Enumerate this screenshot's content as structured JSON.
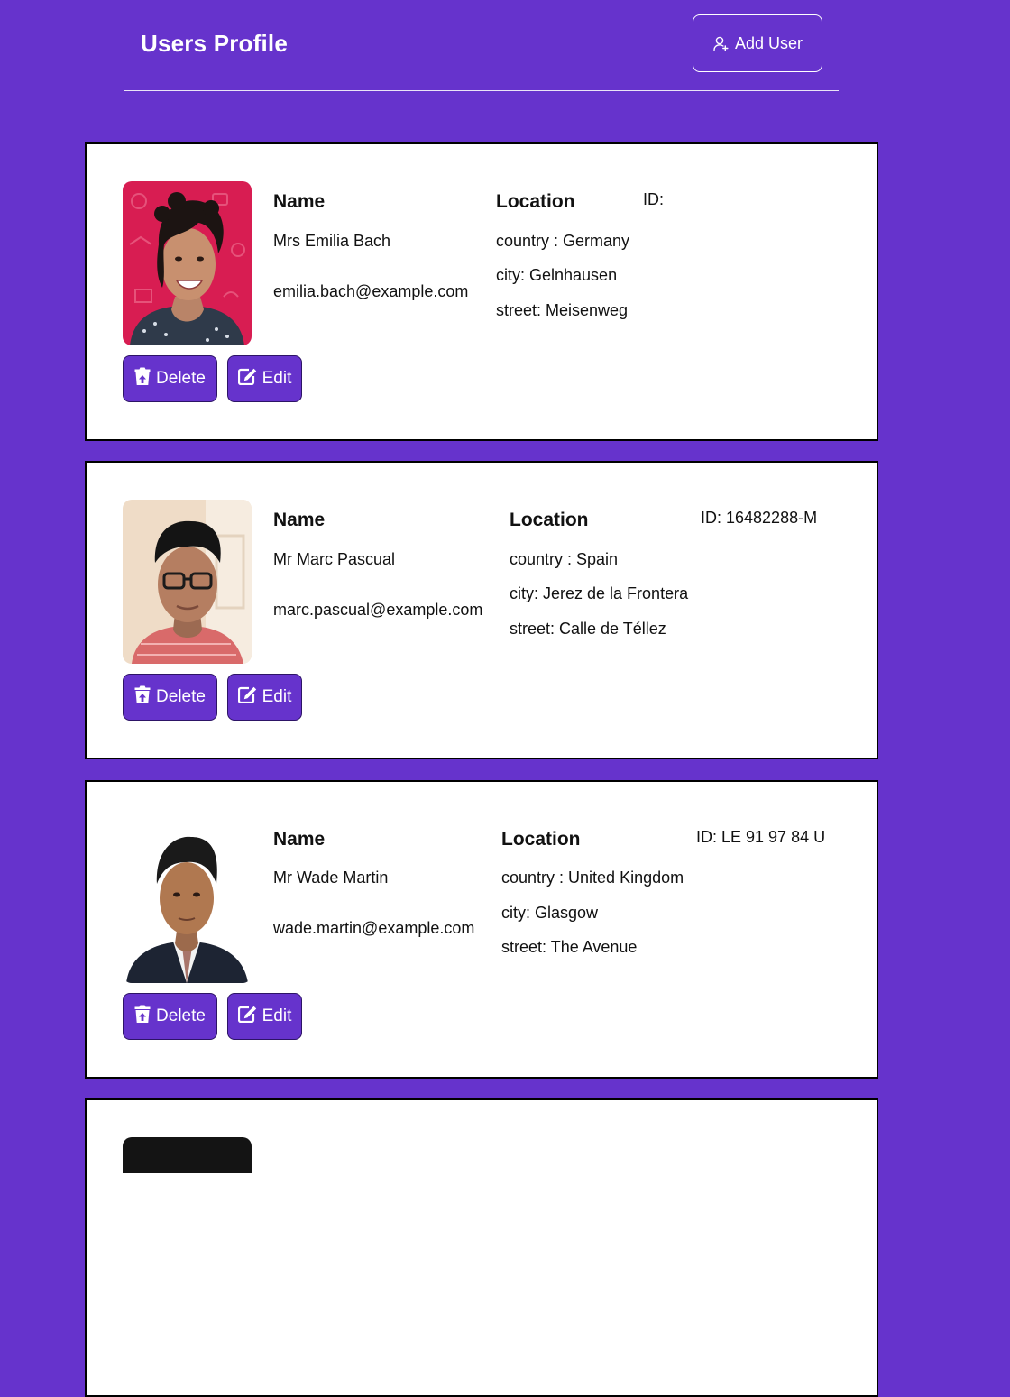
{
  "header": {
    "title": "Users Profile",
    "add_user_label": "Add User",
    "add_user_icon": "user-plus-icon"
  },
  "labels": {
    "name_heading": "Name",
    "location_heading": "Location",
    "country_prefix": "country : ",
    "city_prefix": "city: ",
    "street_prefix": "street: ",
    "id_prefix": "ID: "
  },
  "actions": {
    "delete_label": "Delete",
    "delete_icon": "trash-restore-icon",
    "edit_label": "Edit",
    "edit_icon": "edit-icon"
  },
  "colors": {
    "background": "#6633cc",
    "card": "#ffffff",
    "button": "#6633cc"
  },
  "users": [
    {
      "name": "Mrs Emilia Bach",
      "email": "emilia.bach@example.com",
      "country": "Germany",
      "city": "Gelnhausen",
      "street": "Meisenweg",
      "id": "",
      "country_line": "country : Germany",
      "city_line": "city: Gelnhausen",
      "street_line": "street: Meisenweg",
      "id_line": "ID:",
      "avatar": "user-photo"
    },
    {
      "name": "Mr Marc Pascual",
      "email": "marc.pascual@example.com",
      "country": "Spain",
      "city": "Jerez de la Frontera",
      "street": "Calle de Téllez",
      "id": "16482288-M",
      "country_line": "country : Spain",
      "city_line": "city: Jerez de la Frontera",
      "street_line": "street: Calle de Téllez",
      "id_line": "ID: 16482288-M",
      "avatar": "user-photo"
    },
    {
      "name": "Mr Wade Martin",
      "email": "wade.martin@example.com",
      "country": "United Kingdom",
      "city": "Glasgow",
      "street": "The Avenue",
      "id": "LE 91 97 84 U",
      "country_line": "country : United Kingdom",
      "city_line": "city: Glasgow",
      "street_line": "street: The Avenue",
      "id_line": "ID: LE 91 97 84 U",
      "avatar": "user-photo"
    }
  ]
}
